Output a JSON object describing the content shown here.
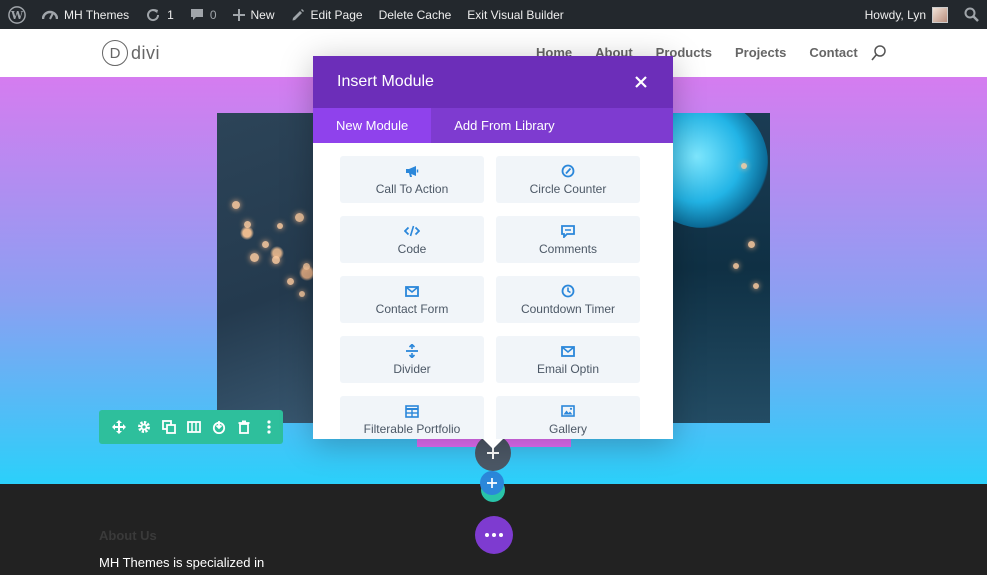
{
  "adminbar": {
    "site_name": "MH Themes",
    "updates_count": "1",
    "comments_count": "0",
    "new_label": "New",
    "edit_label": "Edit Page",
    "cache_label": "Delete Cache",
    "exit_label": "Exit Visual Builder",
    "howdy": "Howdy, Lyn"
  },
  "header": {
    "logo_letter": "D",
    "logo_text": "divi",
    "nav": [
      "Home",
      "About",
      "Products",
      "Projects",
      "Contact"
    ]
  },
  "modal": {
    "title": "Insert Module",
    "tabs": [
      "New Module",
      "Add From Library"
    ],
    "modules": [
      {
        "label": "Call To Action",
        "icon": "megaphone-icon"
      },
      {
        "label": "Circle Counter",
        "icon": "circle-counter-icon"
      },
      {
        "label": "Code",
        "icon": "code-icon"
      },
      {
        "label": "Comments",
        "icon": "comment-icon"
      },
      {
        "label": "Contact Form",
        "icon": "envelope-icon"
      },
      {
        "label": "Countdown Timer",
        "icon": "clock-icon"
      },
      {
        "label": "Divider",
        "icon": "divider-icon"
      },
      {
        "label": "Email Optin",
        "icon": "envelope-icon"
      },
      {
        "label": "Filterable Portfolio",
        "icon": "grid-icon"
      },
      {
        "label": "Gallery",
        "icon": "image-icon"
      }
    ]
  },
  "footer": {
    "about_title": "About Us",
    "about_text": "MH Themes is specialized in"
  },
  "colors": {
    "builder_purple": "#6c2eb9",
    "tab_active": "#8f42ec",
    "row_toolbar": "#2ebf9c",
    "module_icon": "#2b87da"
  }
}
